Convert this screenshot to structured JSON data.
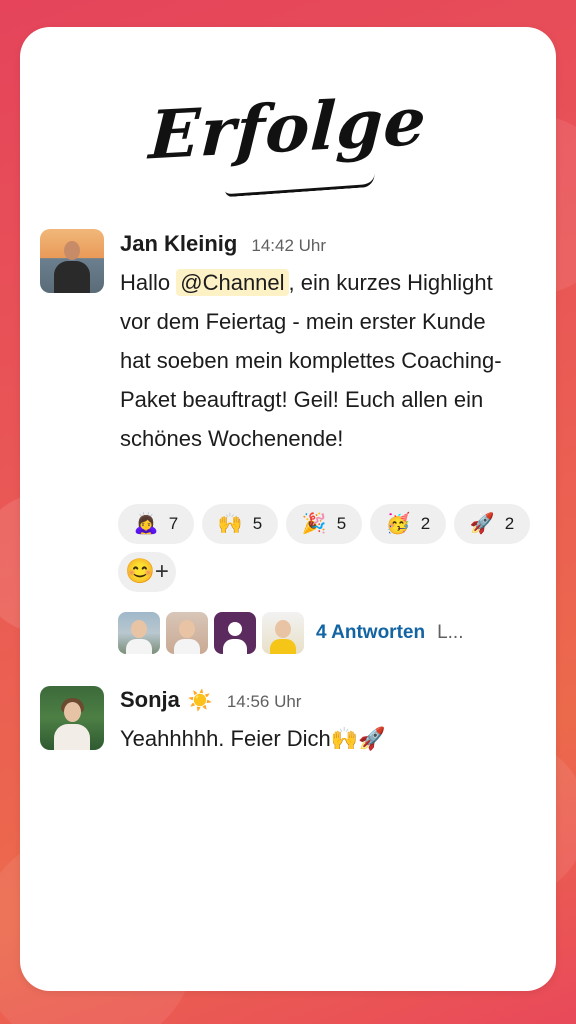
{
  "colors": {
    "background_gradient_start": "#e5445b",
    "background_gradient_end": "#ec6a4c",
    "card": "#ffffff",
    "mention_bg": "#fdf1c6",
    "link": "#1264a3"
  },
  "headline": "Erfolge",
  "messages": [
    {
      "author": "Jan Kleinig",
      "time": "14:42 Uhr",
      "text_before_mention": "Hallo ",
      "mention": "@Channel",
      "text_after_mention": ", ein kurzes Highlight vor dem Feiertag - mein erster Kunde hat soeben mein komplettes Coaching-Paket beauftragt! Geil! Euch allen ein schönes Wochenende!",
      "reactions": [
        {
          "emoji": "🙇‍♀️",
          "icon": "bowing-woman-icon",
          "count": "7"
        },
        {
          "emoji": "🙌",
          "icon": "raising-hands-icon",
          "count": "5"
        },
        {
          "emoji": "🎉",
          "icon": "party-popper-icon",
          "count": "5"
        },
        {
          "emoji": "🥳",
          "icon": "partying-face-icon",
          "count": "2"
        },
        {
          "emoji": "🚀",
          "icon": "rocket-icon",
          "count": "2"
        }
      ],
      "add_reaction_icon": "😊+",
      "thread": {
        "replies_label": "4 Antworten",
        "last_reply_label": "L..."
      }
    },
    {
      "author": "Sonja",
      "status_emoji": "☀️",
      "time": "14:56 Uhr",
      "text": "Yeahhhhh. Feier Dich🙌🚀"
    }
  ]
}
